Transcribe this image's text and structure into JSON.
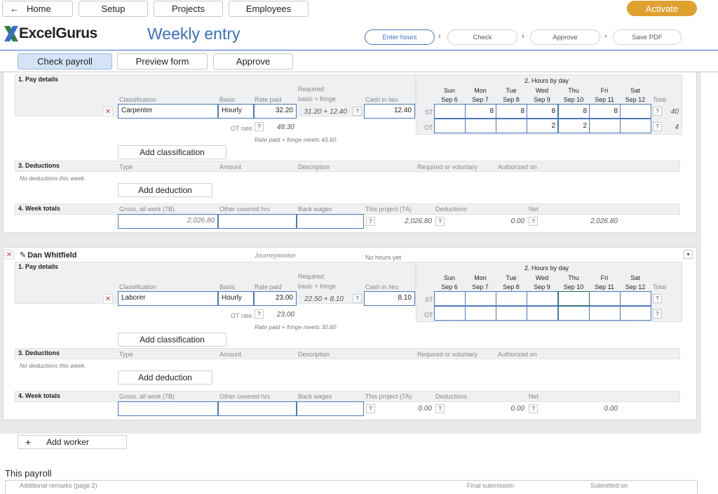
{
  "nav": {
    "home": "Home",
    "setup": "Setup",
    "projects": "Projects",
    "employees": "Employees",
    "activate": "Activate"
  },
  "brand": {
    "logo_text": "ExcelGurus",
    "page_title": "Weekly entry"
  },
  "steps": [
    "Enter hours",
    "Check",
    "Approve",
    "Save PDF"
  ],
  "tabs": [
    "Check payroll",
    "Preview form",
    "Approve"
  ],
  "days": [
    {
      "d": "Sun",
      "dt": "Sep 6"
    },
    {
      "d": "Mon",
      "dt": "Sep 7"
    },
    {
      "d": "Tue",
      "dt": "Sep 8"
    },
    {
      "d": "Wed",
      "dt": "Sep 9"
    },
    {
      "d": "Thu",
      "dt": "Sep 10"
    },
    {
      "d": "Fri",
      "dt": "Sep 11"
    },
    {
      "d": "Sat",
      "dt": "Sep 12"
    }
  ],
  "labels": {
    "pay_details": "1. Pay details",
    "hours_by_day": "2. Hours by day",
    "deductions": "3. Deductions",
    "week_totals": "4. Week totals",
    "classification": "Classification",
    "basis": "Basis",
    "rate_paid": "Rate paid",
    "required": "Required:",
    "basic_fringe": "basic + fringe",
    "cash_in_lieu": "Cash in lieu",
    "total": "Total",
    "st": "ST",
    "ot": "OT",
    "ot_rate": "OT rate",
    "add_classification": "Add classification",
    "add_deduction": "Add deduction",
    "type": "Type",
    "amount": "Amount",
    "description": "Description",
    "req_vol": "Required or voluntary",
    "authorized_on": "Authorized on",
    "no_deductions": "No deductions this week.",
    "gross": "Gross, all work (7B)",
    "other_hrs": "Other covered hrs",
    "back_wages": "Back wages",
    "this_project": "This project (7A)",
    "deductions_col": "Deductions",
    "net": "Net",
    "q": "?"
  },
  "worker1": {
    "classification": "Carpenter",
    "basis": "Hourly",
    "rate_paid": "32.20",
    "required": "31.20 + 12.40",
    "cash": "12.40",
    "ot_rate": "48.30",
    "meets": "Rate paid + fringe meets 43.60",
    "st_hours": [
      "",
      "8",
      "8",
      "8",
      "8",
      "8",
      ""
    ],
    "ot_hours": [
      "",
      "",
      "",
      "2",
      "2",
      "",
      ""
    ],
    "st_total": "40",
    "ot_total": "4",
    "gross": "2,026.80",
    "this_project": "2,026.80",
    "deductions": "0.00",
    "net": "2,026.80"
  },
  "worker2": {
    "name": "Dan Whitfield",
    "role": "Journeyworker",
    "status": "No hours yet",
    "classification": "Laborer",
    "basis": "Hourly",
    "rate_paid": "23.00",
    "required": "22.50 + 8.10",
    "cash": "8.10",
    "ot_rate": "23.00",
    "meets": "Rate paid + fringe meets 30.60",
    "this_project": "0.00",
    "deductions": "0.00",
    "net": "0.00"
  },
  "footer": {
    "add_worker": "Add worker",
    "this_payroll": "This payroll",
    "remarks": "Additional remarks (page 2)",
    "final": "Final submission",
    "submitted": "Submitted on"
  },
  "colors": {
    "accent": "#e0a030",
    "brand_blue": "#3a6fc4",
    "tab_active": "#d5e3f6"
  }
}
